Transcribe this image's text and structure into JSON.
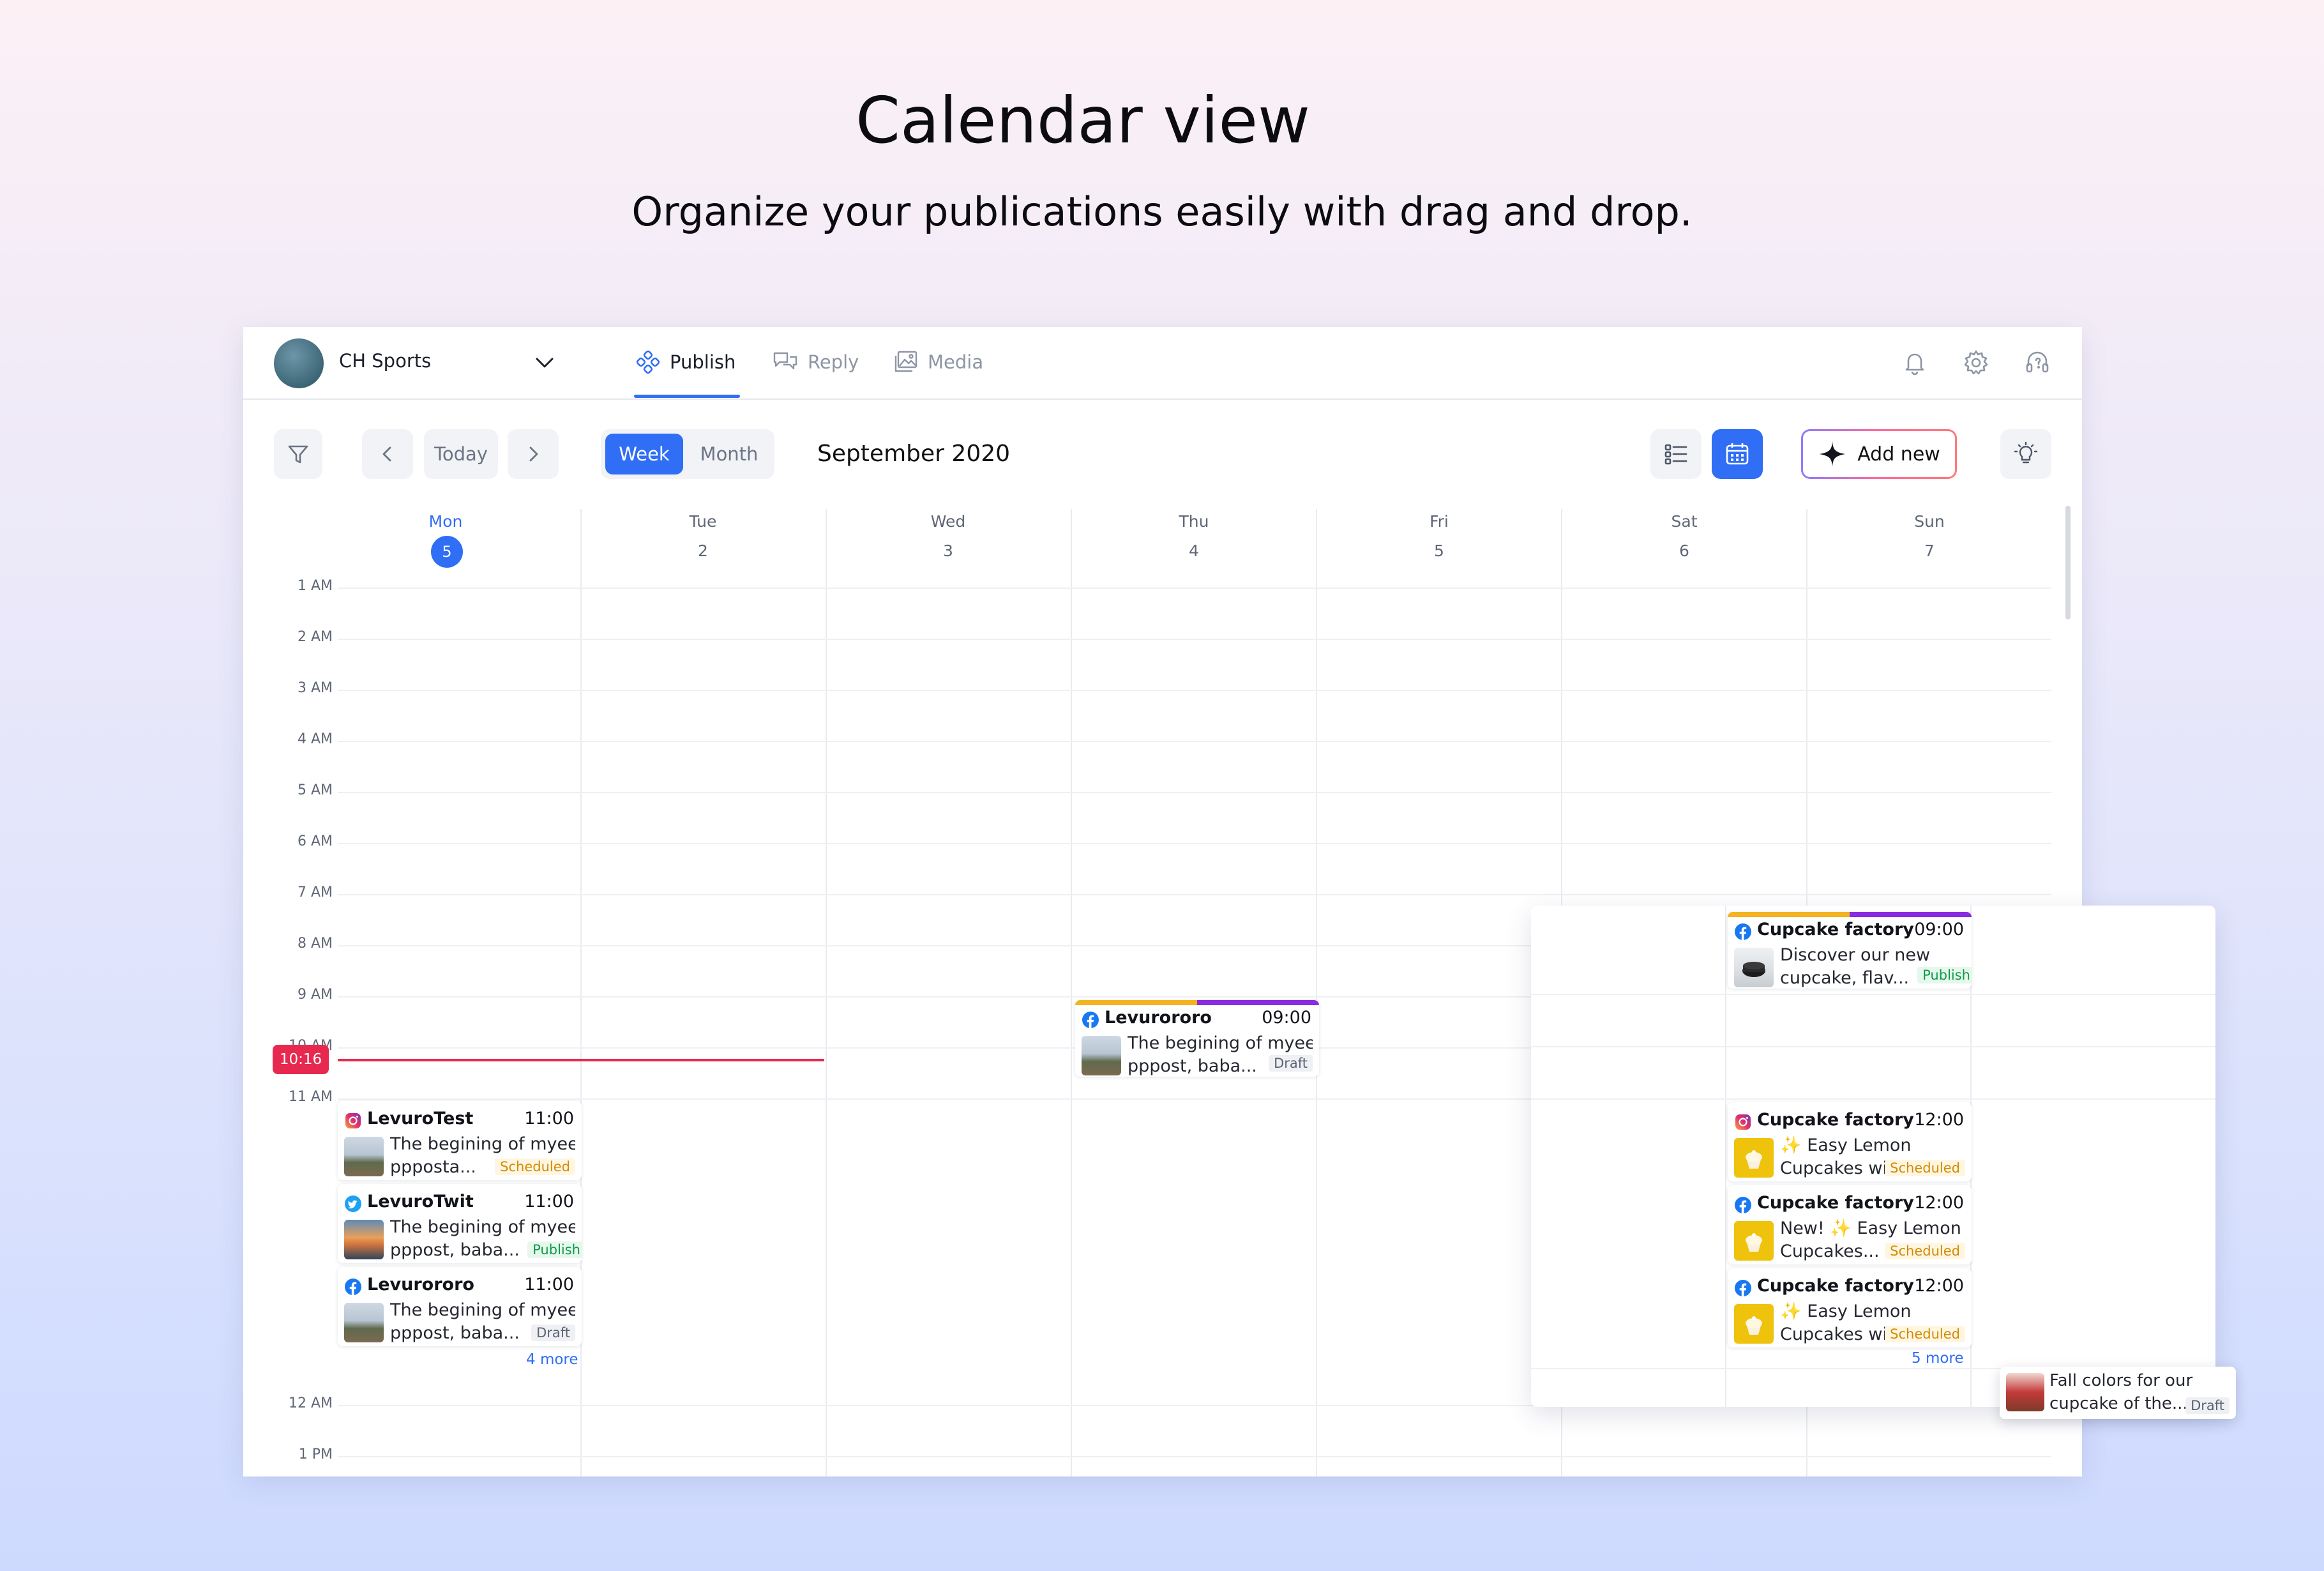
{
  "hero": {
    "title": "Calendar view",
    "subtitle": "Organize your publications easily with drag and drop."
  },
  "topbar": {
    "account_name": "CH Sports",
    "nav": [
      {
        "label": "Publish",
        "active": true,
        "icon": "publish-icon"
      },
      {
        "label": "Reply",
        "active": false,
        "icon": "reply-icon"
      },
      {
        "label": "Media",
        "active": false,
        "icon": "media-icon"
      }
    ],
    "right_icons": [
      "bell-icon",
      "gear-icon",
      "help-headset-icon"
    ]
  },
  "toolbar": {
    "today_label": "Today",
    "week_label": "Week",
    "month_label": "Month",
    "period": "September 2020",
    "add_new_label": "Add new"
  },
  "days": [
    {
      "name": "Mon",
      "num": "5",
      "today": true
    },
    {
      "name": "Tue",
      "num": "2"
    },
    {
      "name": "Wed",
      "num": "3"
    },
    {
      "name": "Thu",
      "num": "4"
    },
    {
      "name": "Fri",
      "num": "5"
    },
    {
      "name": "Sat",
      "num": "6"
    },
    {
      "name": "Sun",
      "num": "7"
    }
  ],
  "hours": [
    "1 AM",
    "2 AM",
    "3 AM",
    "4 AM",
    "5 AM",
    "6 AM",
    "7 AM",
    "8 AM",
    "9 AM",
    "10 AM",
    "11 AM",
    "12 AM",
    "1 PM"
  ],
  "now_time": "10:16",
  "colors": {
    "accent": "#2f6ef5",
    "now": "#e8294f",
    "instagram": "#e1306c",
    "facebook": "#1877f2",
    "twitter": "#1da1f2"
  },
  "posts": {
    "mon1": {
      "network": "instagram",
      "name": "LevuroTest",
      "time": "11:00",
      "line1": "The begining of myee",
      "line2": "ppposta...",
      "status": "Scheduled"
    },
    "mon2": {
      "network": "twitter",
      "name": "LevuroTwit",
      "time": "11:00",
      "line1": "The begining of myee",
      "line2": "pppost, baba...",
      "status": "Publish"
    },
    "mon3": {
      "network": "facebook",
      "name": "Levurororo",
      "time": "11:00",
      "line1": "The begining of myee",
      "line2": "pppost, baba...",
      "status": "Draft"
    },
    "thu1": {
      "network": "facebook",
      "name": "Levurororo",
      "time": "09:00",
      "line1": "The begining of myee",
      "line2": "pppost, baba...",
      "status": "Draft"
    },
    "sat1": {
      "network": "facebook",
      "name": "Cupcake factory",
      "time": "09:00",
      "line1": "Discover our new",
      "line2": "cupcake, flav...",
      "status": "Publish"
    },
    "sat2": {
      "network": "instagram",
      "name": "Cupcake factory",
      "time": "12:00",
      "line1": "✨ Easy Lemon",
      "line2": "Cupcakes wi",
      "status": "Scheduled"
    },
    "sat3": {
      "network": "facebook",
      "name": "Cupcake factory",
      "time": "12:00",
      "line1": "New! ✨ Easy Lemon",
      "line2": "Cupcakes...",
      "status": "Scheduled"
    },
    "sat4": {
      "network": "facebook",
      "name": "Cupcake factory",
      "time": "12:00",
      "line1": "✨ Easy Lemon",
      "line2": "Cupcakes wit",
      "status": "Scheduled"
    },
    "drag": {
      "line1": "Fall colors for our",
      "line2": "cupcake of the...",
      "status": "Draft"
    }
  },
  "more": {
    "mon": "4 more",
    "sat": "5 more"
  }
}
